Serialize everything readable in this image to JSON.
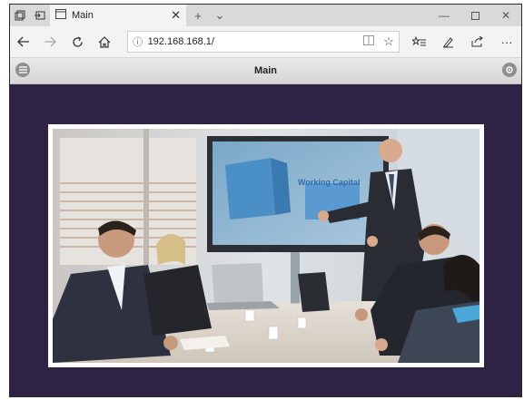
{
  "browser": {
    "tab_title": "Main",
    "new_tab_symbol": "+",
    "tab_list_symbol": "⌄",
    "address_url": "192.168.168.1/"
  },
  "app": {
    "title": "Main"
  },
  "photo": {
    "screen_text": "Working Capital"
  },
  "icons": {
    "back": "arrow-left-icon",
    "forward": "arrow-right-icon",
    "refresh": "refresh-icon",
    "home": "home-icon",
    "favorite": "star-icon",
    "menu": "hamburger-menu-icon",
    "settings": "gear-icon"
  },
  "colors": {
    "page_background": "#2e2245",
    "appbar_top": "#e9e9e9",
    "browser_chrome": "#f3f3f3"
  }
}
